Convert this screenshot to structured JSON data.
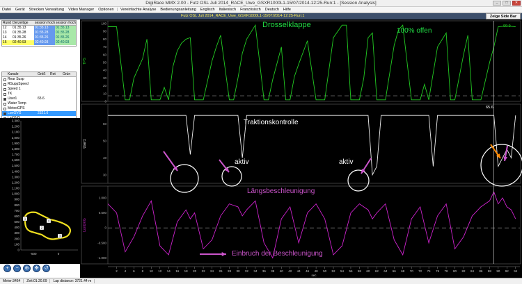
{
  "window": {
    "app": "DigiRace MMX 2.00 -",
    "title": "Futz OSL Juli 2014_RACE_Uwe_GSXR1000L1-15/07/2014-12:25-Run:1 - [Session Analysis]"
  },
  "menu": [
    "Datei",
    "Gerät",
    "Strecken Verwaltung",
    "Video Manager",
    "Optionen",
    "Vereinfachte Analyse",
    "Bedienungsanleitung",
    "Englisch",
    "Italienisch",
    "Französisch",
    "Deutsch",
    "Hilfe"
  ],
  "session": {
    "title": "Futz OSL Juli 2014_RACE_Uwe_GSXR1000L1-15/07/2014-12:25-Run:1",
    "side_bar_button": "Zeige Side Bar"
  },
  "laps": {
    "headers": [
      "Rund",
      "Derzeitige",
      "session hoch",
      "session hoch"
    ],
    "rows": [
      {
        "n": "12",
        "t": "01:35.13",
        "a": "01:35.13",
        "b": "01:35.13"
      },
      {
        "n": "13",
        "t": "01:35.28",
        "a": "01:35.28",
        "b": "01:35.28"
      },
      {
        "n": "14",
        "t": "01:35.26",
        "a": "01:35.26",
        "b": "01:35.26"
      },
      {
        "n": "15",
        "t": "02:40.93",
        "a": "02:40.93",
        "b": "02:40.93"
      }
    ]
  },
  "channels": {
    "headers": [
      "Kanale",
      "Größ",
      "Rot",
      "Grün"
    ],
    "rows": [
      {
        "name": "Rear Susp",
        "val": "",
        "on": false,
        "sel": false
      },
      {
        "name": "RSuppSpeed",
        "val": "",
        "on": false,
        "sel": false
      },
      {
        "name": "Speed 1",
        "val": "",
        "on": false,
        "sel": false
      },
      {
        "name": "TK",
        "val": "",
        "on": false,
        "sel": false
      },
      {
        "name": "User1",
        "val": "65.6",
        "on": true,
        "sel": false
      },
      {
        "name": "Water Temp",
        "val": "",
        "on": false,
        "sel": false
      },
      {
        "name": "MeteoGPS",
        "val": "",
        "on": false,
        "sel": false
      },
      {
        "name": "LonGVG",
        "val": "2321.6",
        "on": true,
        "sel": true
      },
      {
        "name": "LatGVG",
        "val": "",
        "on": false,
        "sel": false
      }
    ]
  },
  "map": {
    "yticks": [
      "2,300",
      "2,200",
      "2,100",
      "2,000",
      "1,900",
      "1,800",
      "1,700",
      "1,600",
      "1,500",
      "1,400",
      "1,300",
      "1,200",
      "1,100",
      "1,000",
      "900",
      "800",
      "700",
      "600",
      "500",
      "400",
      "300",
      "200",
      "100",
      "0"
    ],
    "xticks": [
      "-500",
      "0"
    ],
    "markers": [
      "1",
      "2",
      "3",
      "4"
    ],
    "color": "#f0e020"
  },
  "map_tools": [
    "zoom-in",
    "zoom-out",
    "zoom-fit",
    "pan",
    "reset"
  ],
  "statusbar": {
    "meter": "Meter:3464",
    "zeit": "Zeit:01:20.09",
    "lap": "Lap distance: 3721.44 m"
  },
  "annotations": {
    "drossel": "Drosselklappe",
    "offen": "100% offen",
    "traktion": "Traktionskontrolle",
    "aktiv1": "aktiv",
    "aktiv2": "aktiv",
    "laengs": "Längsbeschleunigung",
    "einbruch": "Einbruch der Beschleunigung",
    "tps_val": "99.9",
    "user_val": "65.6"
  },
  "colors": {
    "tps": "#22cc22",
    "user": "#eeeeee",
    "long": "#cc22cc",
    "annot_green": "#22dd44",
    "annot_white": "#ffffff",
    "annot_magenta": "#cc55cc",
    "arrow_orange": "#ff8800"
  },
  "chart_data": {
    "type": "line",
    "xlabel": "sec",
    "xticks": [
      "2",
      "4",
      "6",
      "8",
      "10",
      "12",
      "14",
      "16",
      "18",
      "20",
      "22",
      "24",
      "26",
      "28",
      "30",
      "32",
      "34",
      "36",
      "38",
      "40",
      "42",
      "44",
      "46",
      "48",
      "50",
      "52",
      "54",
      "56",
      "58",
      "60",
      "62",
      "64",
      "66",
      "68",
      "70",
      "72",
      "74",
      "76",
      "78",
      "80",
      "82",
      "84",
      "86",
      "88",
      "90",
      "92",
      "94"
    ],
    "panels": [
      {
        "ylabel": "TPS",
        "ylim": [
          0,
          100
        ],
        "yticks": [
          "0",
          "10",
          "20",
          "30",
          "40",
          "50",
          "60",
          "70",
          "80",
          "90",
          "100"
        ],
        "series": [
          {
            "name": "TPS",
            "x": [
              0,
              2,
              4,
              5,
              6,
              8,
              9,
              10,
              12,
              13,
              14,
              15,
              16,
              17,
              18,
              19,
              20,
              22,
              24,
              25,
              26,
              28,
              29,
              30,
              31,
              32,
              34,
              36,
              37,
              38,
              40,
              41,
              42,
              43,
              44,
              46,
              48,
              50,
              52,
              54,
              55,
              56,
              58,
              59,
              60,
              61,
              62,
              64,
              66,
              67,
              68,
              70,
              72,
              73,
              74,
              76,
              78,
              79,
              80,
              82,
              83,
              84,
              86,
              88,
              89,
              90,
              92,
              94
            ],
            "y": [
              96,
              96,
              2,
              2,
              30,
              55,
              80,
              2,
              2,
              18,
              2,
              45,
              65,
              75,
              80,
              82,
              2,
              2,
              52,
              70,
              85,
              2,
              2,
              30,
              62,
              80,
              98,
              2,
              2,
              28,
              70,
              2,
              2,
              32,
              48,
              78,
              2,
              2,
              82,
              98,
              98,
              2,
              2,
              30,
              82,
              88,
              2,
              2,
              72,
              92,
              98,
              2,
              2,
              22,
              2,
              70,
              88,
              2,
              2,
              60,
              85,
              2,
              2,
              50,
              70,
              96,
              97,
              96
            ]
          }
        ]
      },
      {
        "ylabel": "User1",
        "ylim": [
          25,
          70
        ],
        "yticks": [
          "30",
          "40",
          "50",
          "60"
        ],
        "series": [
          {
            "name": "User1",
            "x": [
              0,
              18,
              19,
              20,
              30,
              31,
              32,
              60,
              61,
              62,
              63,
              74,
              75,
              76,
              88,
              89,
              90,
              91,
              92,
              93,
              94
            ],
            "y": [
              65,
              65,
              42,
              65,
              65,
              40,
              65,
              65,
              30,
              35,
              65,
              65,
              35,
              65,
              65,
              65,
              35,
              40,
              45,
              40,
              65
            ]
          }
        ]
      },
      {
        "ylabel": "LonGVG",
        "ylim": [
          -1.2,
          1.3
        ],
        "yticks": [
          "-1.000",
          "-0.500",
          "0",
          "0.500",
          "1.000"
        ],
        "series": [
          {
            "name": "LonGVG",
            "x": [
              0,
              2,
              4,
              6,
              8,
              10,
              12,
              14,
              16,
              18,
              19,
              20,
              22,
              24,
              26,
              28,
              30,
              31,
              32,
              34,
              36,
              38,
              40,
              42,
              44,
              46,
              48,
              50,
              52,
              54,
              56,
              58,
              60,
              61,
              62,
              64,
              66,
              68,
              70,
              72,
              74,
              76,
              78,
              80,
              82,
              84,
              86,
              88,
              89,
              90,
              91,
              92,
              93,
              94
            ],
            "y": [
              0.8,
              0.5,
              -0.8,
              -0.3,
              0.4,
              0.9,
              -0.6,
              -0.9,
              0.2,
              0.6,
              0.3,
              0.5,
              -0.7,
              -0.4,
              0.4,
              0.8,
              0.7,
              0.4,
              0.6,
              0.9,
              -0.5,
              -1.0,
              0.3,
              0.7,
              -0.5,
              0.5,
              0.8,
              0.3,
              -0.9,
              -0.6,
              0.5,
              0.8,
              0.6,
              0.3,
              0.5,
              0.8,
              -0.4,
              -0.9,
              0.3,
              0.7,
              -0.5,
              0.4,
              0.8,
              -0.7,
              -0.3,
              0.4,
              0.7,
              0.9,
              1.2,
              0.8,
              1.0,
              0.7,
              0.6,
              0.3
            ]
          }
        ]
      }
    ]
  }
}
